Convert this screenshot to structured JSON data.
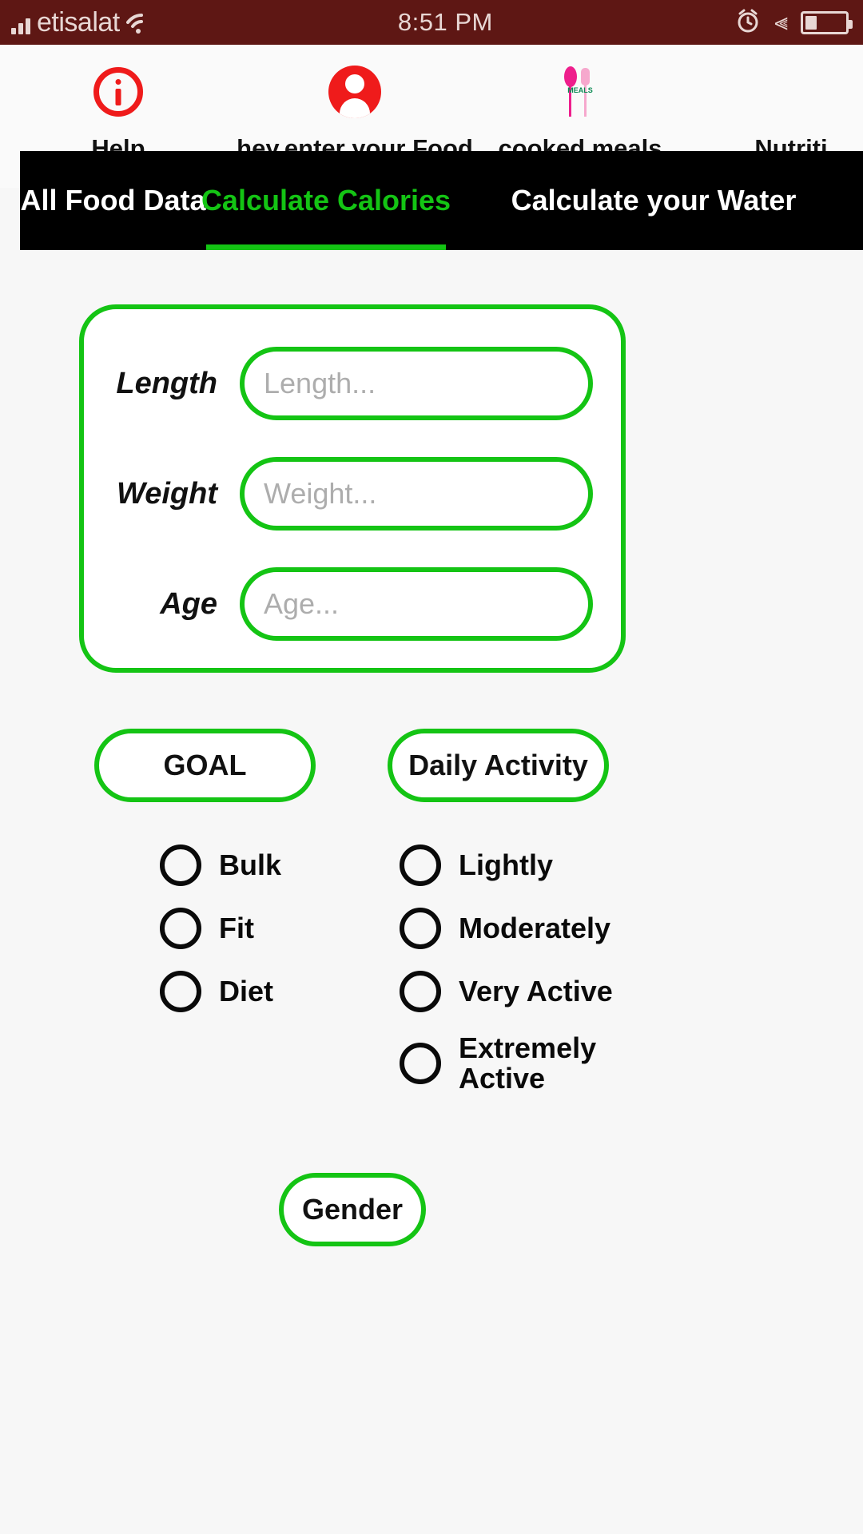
{
  "status_bar": {
    "carrier": "etisalat",
    "time": "8:51 PM",
    "signal_icon": "signal-bars-icon",
    "wifi_icon": "wifi-icon",
    "alarm_icon": "alarm-clock-icon",
    "bluetooth_icon": "bluetooth-icon",
    "bluetooth_glyph": "⫷",
    "battery_icon": "battery-icon",
    "background_color": "#5e1714",
    "text_color": "#e8d7d4"
  },
  "top_nav": {
    "items": [
      {
        "label": "Help",
        "icon": "info-circle-icon",
        "icon_color": "#ef1b1b"
      },
      {
        "label": "hey,enter your Food",
        "icon": "account-person-icon",
        "icon_color": "#ef1b1b"
      },
      {
        "label": "cooked meals",
        "icon": "meals-spoon-fork-icon",
        "icon_color": "#ee3d8f",
        "icon_caption": "MEALS"
      },
      {
        "label": "Nutriti",
        "icon": "nutrition-icon",
        "icon_color": "#ef1b1b"
      }
    ]
  },
  "tab_bar": {
    "background_color": "#000000",
    "active_color": "#14c414",
    "inactive_color": "#ffffff",
    "active_index": 1,
    "tabs": [
      {
        "label": "All Food Data"
      },
      {
        "label": "Calculate Calories"
      },
      {
        "label": "Calculate your Water"
      }
    ]
  },
  "form_card": {
    "accent_color": "#14c414",
    "fields": [
      {
        "label": "Length",
        "placeholder": "Length...",
        "value": ""
      },
      {
        "label": "Weight",
        "placeholder": "Weight...",
        "value": ""
      },
      {
        "label": "Age",
        "placeholder": "Age...",
        "value": ""
      }
    ]
  },
  "selectors": {
    "goal_button": "GOAL",
    "activity_button": "Daily Activity",
    "gender_button": "Gender"
  },
  "goal_options": [
    {
      "label": "Bulk",
      "selected": false
    },
    {
      "label": "Fit",
      "selected": false
    },
    {
      "label": "Diet",
      "selected": false
    }
  ],
  "activity_options": [
    {
      "label": "Lightly",
      "selected": false
    },
    {
      "label": "Moderately",
      "selected": false
    },
    {
      "label": "Very Active",
      "selected": false
    },
    {
      "label": "Extremely Active",
      "selected": false
    }
  ]
}
